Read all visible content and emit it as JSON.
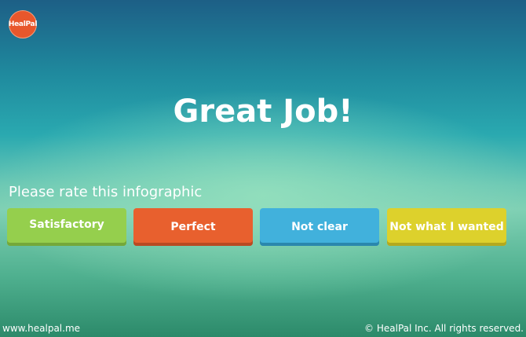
{
  "brand": {
    "logo_text": "HealPal",
    "logo_color": "#e8572c"
  },
  "main": {
    "headline": "Great Job!",
    "rating_prompt": "Please rate this infographic",
    "rating_options": [
      {
        "label": "Satisfactory",
        "color": "#95cf4d"
      },
      {
        "label": "Perfect",
        "color": "#e8602e"
      },
      {
        "label": "Not clear",
        "color": "#41b1dc"
      },
      {
        "label": "Not what I wanted",
        "color": "#ddd12c"
      }
    ]
  },
  "footer": {
    "website": "www.healpal.me",
    "copyright": "© HealPal Inc. All rights reserved."
  }
}
